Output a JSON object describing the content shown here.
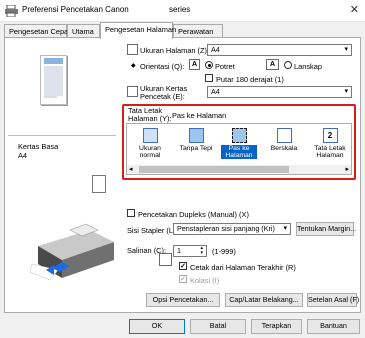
{
  "window": {
    "title": "Preferensi Pencetakan Canon ",
    "title_suffix": "series",
    "close": "✕"
  },
  "tabs": [
    {
      "label": "Pengesetan Cepat"
    },
    {
      "label": "Utama"
    },
    {
      "label": "Pengesetan Halaman"
    },
    {
      "label": "Perawatan"
    }
  ],
  "preview": {
    "paper_label": "Kertas Basa",
    "paper_size": "A4"
  },
  "page_size": {
    "label": "Ukuran Halaman (Z):",
    "value": "A4"
  },
  "orientation": {
    "label": "Orientasi (Q):",
    "portrait": "Potret",
    "landscape": "Lanskap",
    "rotate": "Putar 180 derajat (1)",
    "portrait_icon": "A"
  },
  "printer_paper": {
    "label_1": "Ukuran Kertas",
    "label_2": "Pencetak (E):",
    "value": "A4"
  },
  "layout": {
    "label_1": "Tata Letak",
    "label_2": "Halaman (Y):",
    "current": "Pas ke Halaman",
    "options": [
      {
        "label": "Ukuran normal"
      },
      {
        "label": "Tanpa Tepi"
      },
      {
        "label": "Pas ke Halaman"
      },
      {
        "label": "Berskala"
      },
      {
        "label": "Tata Letak Halaman",
        "icon": "2"
      }
    ]
  },
  "duplex": {
    "label": "Pencetakan Dupleks (Manual) (X)"
  },
  "stapling": {
    "label": "Sisi Stapler (L):",
    "value": "Penstapleran sisi panjang (Kri)",
    "margin_button": "Tentukan Margin..."
  },
  "copies": {
    "label": "Salinan (C):",
    "value": "1",
    "range": "(1-999)",
    "last_page": "Cetak dari Halaman Terakhir (R)",
    "collate": "Kolasi (I)"
  },
  "buttons": {
    "print_options": "Opsi Pencetakan...",
    "stamp": "Cap/Latar Belakang...",
    "defaults": "Setelan Asal (F)",
    "ok": "OK",
    "cancel": "Batal",
    "apply": "Terapkan",
    "help": "Bantuan"
  }
}
